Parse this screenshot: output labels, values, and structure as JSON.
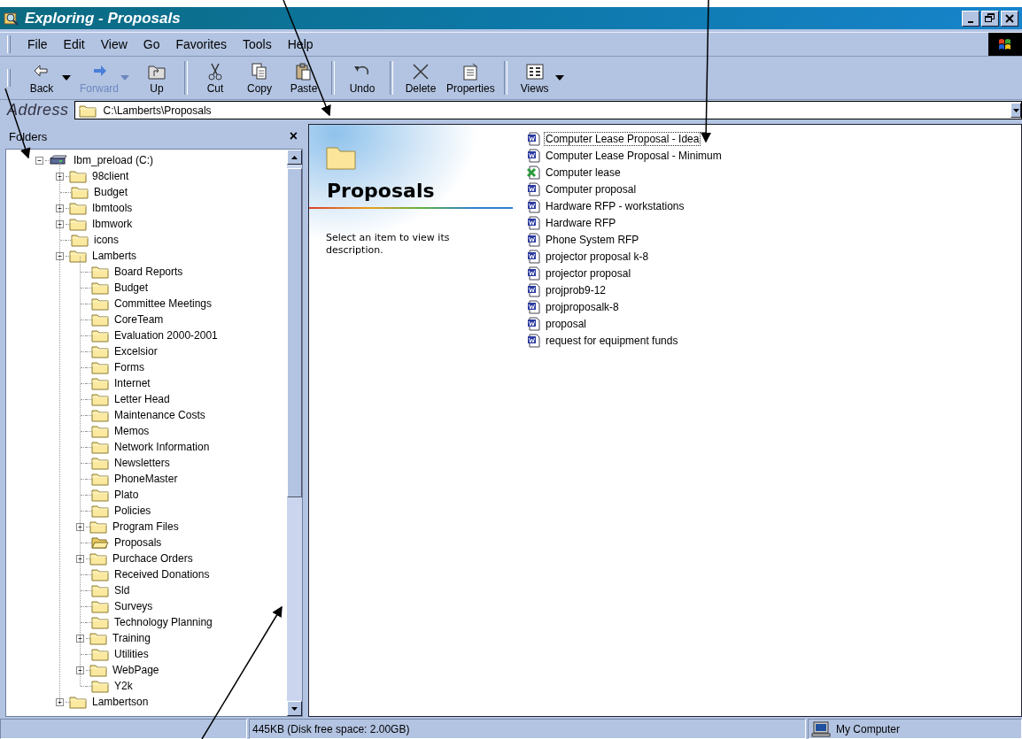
{
  "window": {
    "title": "Exploring - Proposals"
  },
  "menu": [
    {
      "label": "File"
    },
    {
      "label": "Edit"
    },
    {
      "label": "View"
    },
    {
      "label": "Go"
    },
    {
      "label": "Favorites"
    },
    {
      "label": "Tools"
    },
    {
      "label": "Help"
    }
  ],
  "toolbar": [
    {
      "kind": "back",
      "label": "Back",
      "disabled": false,
      "dropdown": true
    },
    {
      "kind": "forward",
      "label": "Forward",
      "disabled": true,
      "dropdown": true
    },
    {
      "kind": "up",
      "label": "Up",
      "disabled": false,
      "dropdown": false
    },
    {
      "kind": "separator"
    },
    {
      "kind": "cut",
      "label": "Cut",
      "disabled": false,
      "dropdown": false
    },
    {
      "kind": "copy",
      "label": "Copy",
      "disabled": false,
      "dropdown": false
    },
    {
      "kind": "paste",
      "label": "Paste",
      "disabled": false,
      "dropdown": false
    },
    {
      "kind": "separator"
    },
    {
      "kind": "undo",
      "label": "Undo",
      "disabled": false,
      "dropdown": false
    },
    {
      "kind": "separator"
    },
    {
      "kind": "delete",
      "label": "Delete",
      "disabled": false,
      "dropdown": false
    },
    {
      "kind": "properties",
      "label": "Properties",
      "disabled": false,
      "dropdown": false
    },
    {
      "kind": "separator"
    },
    {
      "kind": "views",
      "label": "Views",
      "disabled": false,
      "dropdown": true
    }
  ],
  "address": {
    "label": "Address",
    "value": "C:\\Lamberts\\Proposals"
  },
  "folders_pane": {
    "title": "Folders",
    "close": "×",
    "tree": [
      {
        "label": "Ibm_preload (C:)",
        "kind": "drive",
        "expandable": true,
        "expanded": true,
        "selected": false,
        "children": [
          {
            "label": "98client",
            "kind": "folder",
            "expandable": true,
            "expanded": false,
            "selected": false
          },
          {
            "label": "Budget",
            "kind": "folder",
            "expandable": false,
            "selected": false
          },
          {
            "label": "Ibmtools",
            "kind": "folder",
            "expandable": true,
            "expanded": false,
            "selected": false
          },
          {
            "label": "Ibmwork",
            "kind": "folder",
            "expandable": true,
            "expanded": false,
            "selected": false
          },
          {
            "label": "icons",
            "kind": "folder",
            "expandable": false,
            "selected": false
          },
          {
            "label": "Lamberts",
            "kind": "folder",
            "expandable": true,
            "expanded": true,
            "selected": false,
            "children": [
              {
                "label": "Board Reports",
                "kind": "folder",
                "expandable": false,
                "selected": false
              },
              {
                "label": "Budget",
                "kind": "folder",
                "expandable": false,
                "selected": false
              },
              {
                "label": "Committee Meetings",
                "kind": "folder",
                "expandable": false,
                "selected": false
              },
              {
                "label": "CoreTeam",
                "kind": "folder",
                "expandable": false,
                "selected": false
              },
              {
                "label": "Evaluation 2000-2001",
                "kind": "folder",
                "expandable": false,
                "selected": false
              },
              {
                "label": "Excelsior",
                "kind": "folder",
                "expandable": false,
                "selected": false
              },
              {
                "label": "Forms",
                "kind": "folder",
                "expandable": false,
                "selected": false
              },
              {
                "label": "Internet",
                "kind": "folder",
                "expandable": false,
                "selected": false
              },
              {
                "label": "Letter Head",
                "kind": "folder",
                "expandable": false,
                "selected": false
              },
              {
                "label": "Maintenance Costs",
                "kind": "folder",
                "expandable": false,
                "selected": false
              },
              {
                "label": "Memos",
                "kind": "folder",
                "expandable": false,
                "selected": false
              },
              {
                "label": "Network Information",
                "kind": "folder",
                "expandable": false,
                "selected": false
              },
              {
                "label": "Newsletters",
                "kind": "folder",
                "expandable": false,
                "selected": false
              },
              {
                "label": "PhoneMaster",
                "kind": "folder",
                "expandable": false,
                "selected": false
              },
              {
                "label": "Plato",
                "kind": "folder",
                "expandable": false,
                "selected": false
              },
              {
                "label": "Policies",
                "kind": "folder",
                "expandable": false,
                "selected": false
              },
              {
                "label": "Program Files",
                "kind": "folder",
                "expandable": true,
                "expanded": false,
                "selected": false
              },
              {
                "label": "Proposals",
                "kind": "folder",
                "expandable": false,
                "selected": true
              },
              {
                "label": "Purchace Orders",
                "kind": "folder",
                "expandable": true,
                "expanded": false,
                "selected": false
              },
              {
                "label": "Received Donations",
                "kind": "folder",
                "expandable": false,
                "selected": false
              },
              {
                "label": "Sld",
                "kind": "folder",
                "expandable": false,
                "selected": false
              },
              {
                "label": "Surveys",
                "kind": "folder",
                "expandable": false,
                "selected": false
              },
              {
                "label": "Technology Planning",
                "kind": "folder",
                "expandable": false,
                "selected": false
              },
              {
                "label": "Training",
                "kind": "folder",
                "expandable": true,
                "expanded": false,
                "selected": false
              },
              {
                "label": "Utilities",
                "kind": "folder",
                "expandable": false,
                "selected": false
              },
              {
                "label": "WebPage",
                "kind": "folder",
                "expandable": true,
                "expanded": false,
                "selected": false
              },
              {
                "label": "Y2k",
                "kind": "folder",
                "expandable": false,
                "selected": false
              }
            ]
          },
          {
            "label": "Lambertson",
            "kind": "folder",
            "expandable": true,
            "expanded": false,
            "selected": false
          }
        ]
      }
    ]
  },
  "web_view": {
    "heading": "Proposals",
    "description": "Select an item to view its description."
  },
  "files": [
    {
      "name": "Computer Lease Proposal - Idea",
      "kind": "word",
      "focused": true
    },
    {
      "name": "Computer Lease Proposal - Minimum",
      "kind": "word",
      "focused": false
    },
    {
      "name": "Computer lease",
      "kind": "excel",
      "focused": false
    },
    {
      "name": "Computer proposal",
      "kind": "word",
      "focused": false
    },
    {
      "name": "Hardware RFP - workstations",
      "kind": "word",
      "focused": false
    },
    {
      "name": "Hardware RFP",
      "kind": "word",
      "focused": false
    },
    {
      "name": "Phone System RFP",
      "kind": "word",
      "focused": false
    },
    {
      "name": "projector proposal k-8",
      "kind": "word",
      "focused": false
    },
    {
      "name": "projector proposal",
      "kind": "word",
      "focused": false
    },
    {
      "name": "projprob9-12",
      "kind": "word",
      "focused": false
    },
    {
      "name": "projproposalk-8",
      "kind": "word",
      "focused": false
    },
    {
      "name": "proposal",
      "kind": "word",
      "focused": false
    },
    {
      "name": "request for equipment funds",
      "kind": "word",
      "focused": false
    }
  ],
  "status_bar": {
    "size": "445KB (Disk free space: 2.00GB)",
    "zone": "My Computer"
  }
}
